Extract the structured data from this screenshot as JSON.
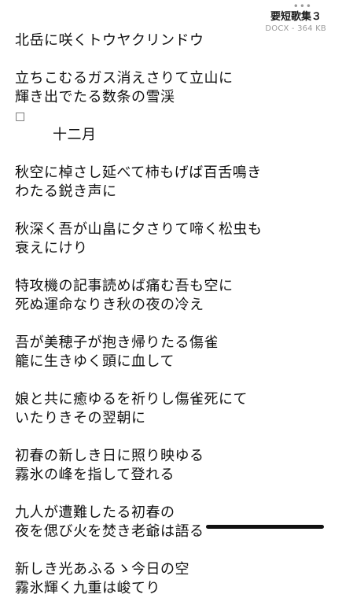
{
  "header": {
    "more": "•••",
    "title": "要短歌集３",
    "meta": "DOCX - 364 KB"
  },
  "doc": {
    "lines": [
      "北岳に咲くトウヤクリンドウ",
      "",
      "立ちこむるガス消えさりて立山に",
      "輝き出でたる数条の雪渓",
      "□",
      "十二月",
      "",
      "秋空に棹さし延べて柿もげば百舌鳴き",
      "わたる鋭き声に",
      "",
      "秋深く吾が山畠に夕さりて啼く松虫も",
      "衰えにけり",
      "",
      "特攻機の記事読めば痛む吾も空に",
      "死ぬ運命なりき秋の夜の冷え",
      "",
      "吾が美穂子が抱き帰りたる傷雀",
      "籠に生きゆく頭に血して",
      "",
      "娘と共に癒ゆるを祈りし傷雀死にて",
      "いたりきその翌朝に",
      "",
      "初春の新しき日に照り映ゆる",
      "霧氷の峰を指して登れる",
      "",
      "九人が遭難したる初春の",
      "夜を偲び火を焚き老爺は語る",
      "",
      "新しき光あふるゝ今日の空",
      "霧氷輝く九重は峻てり"
    ]
  }
}
